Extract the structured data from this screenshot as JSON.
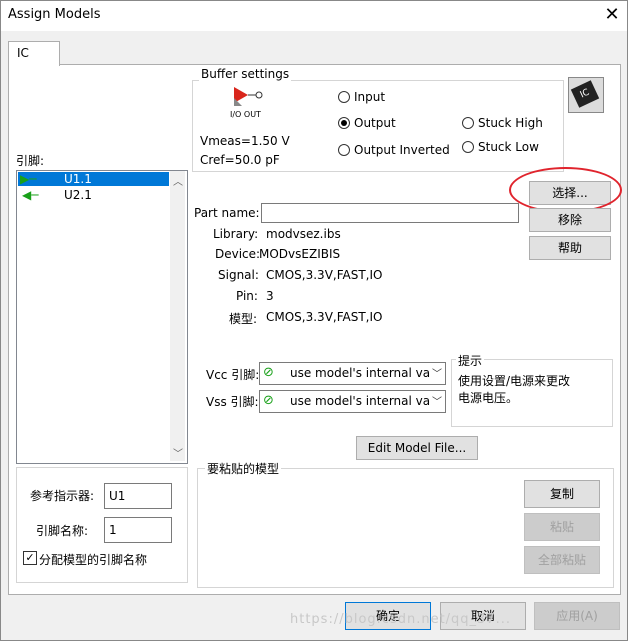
{
  "window": {
    "title": "Assign Models",
    "close_glyph": "✕"
  },
  "tabs": [
    {
      "label": "IC"
    }
  ],
  "pins": {
    "label": "引脚:",
    "items": [
      {
        "name": "U1.1",
        "icon": "output-pin-icon",
        "selected": true
      },
      {
        "name": "U2.1",
        "icon": "input-pin-icon",
        "selected": false
      }
    ]
  },
  "buffer": {
    "legend": "Buffer settings",
    "io_label": "I/O  OUT",
    "vmeas": "Vmeas=1.50 V",
    "cref": "Cref=50.0 pF",
    "options": [
      {
        "label": "Input",
        "checked": false
      },
      {
        "label": "Output",
        "checked": true
      },
      {
        "label": "Output Inverted",
        "checked": false
      },
      {
        "label": "Stuck High",
        "checked": false
      },
      {
        "label": "Stuck Low",
        "checked": false
      }
    ],
    "ic_badge": "IC"
  },
  "model": {
    "part_name_label": "Part name:",
    "part_name_value": "",
    "library_label": "Library:",
    "library_value": "modvsez.ibs",
    "device_label": "Device:",
    "device_value": "MODvsEZIBIS",
    "signal_label": "Signal:",
    "signal_value": "CMOS,3.3V,FAST,IO",
    "pin_label": "Pin:",
    "pin_value": "3",
    "model_label": "模型:",
    "model_value": "CMOS,3.3V,FAST,IO"
  },
  "buttons": {
    "select": "选择...",
    "remove": "移除",
    "help": "帮助",
    "edit_model": "Edit Model File...",
    "copy": "复制",
    "paste": "粘贴",
    "paste_all": "全部粘贴",
    "ok": "确定",
    "cancel": "取消",
    "apply": "应用(A)"
  },
  "power": {
    "vcc_label": "Vcc 引脚:",
    "vcc_value": "use model's internal va",
    "vss_label": "Vss 引脚:",
    "vss_value": "use model's internal va"
  },
  "hint": {
    "legend": "提示",
    "text_line1": "使用设置/电源来更改",
    "text_line2": "电源电压。"
  },
  "paste_group": {
    "legend": "要粘贴的模型"
  },
  "designator": {
    "label": "参考指示器:",
    "value": "U1"
  },
  "pin_name": {
    "label": "引脚名称:",
    "value": "1"
  },
  "assign_checkbox": {
    "label": "分配模型的引脚名称",
    "checked": true
  },
  "watermark": "https://blog.csdn.net/qq_37..."
}
